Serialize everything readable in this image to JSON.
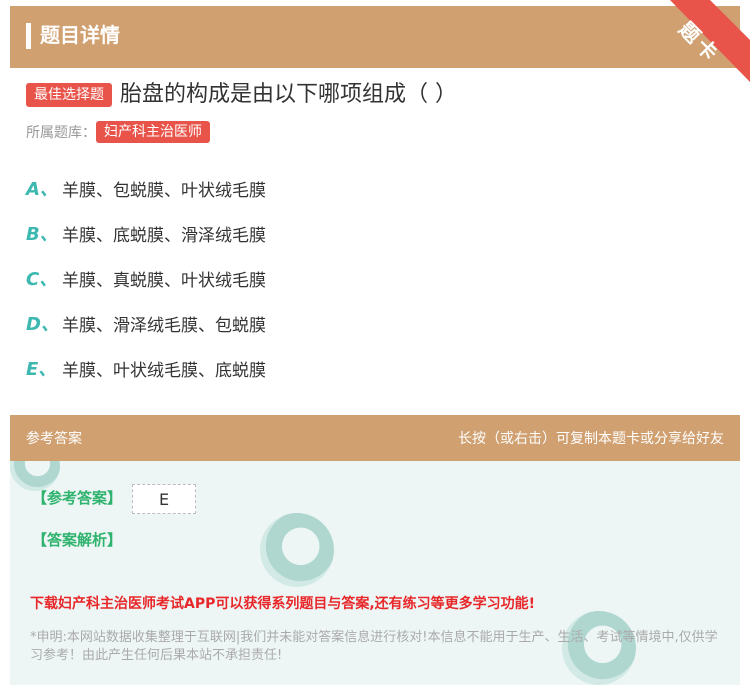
{
  "header": {
    "title": "题目详情",
    "corner_badge": "题卡"
  },
  "question": {
    "type_tag": "最佳选择题",
    "text": "胎盘的构成是由以下哪项组成（ ）",
    "bank_label": "所属题库：",
    "bank_name": "妇产科主治医师"
  },
  "options": [
    {
      "letter": "A、",
      "text": "羊膜、包蜕膜、叶状绒毛膜"
    },
    {
      "letter": "B、",
      "text": "羊膜、底蜕膜、滑泽绒毛膜"
    },
    {
      "letter": "C、",
      "text": "羊膜、真蜕膜、叶状绒毛膜"
    },
    {
      "letter": "D、",
      "text": "羊膜、滑泽绒毛膜、包蜕膜"
    },
    {
      "letter": "E、",
      "text": "羊膜、叶状绒毛膜、底蜕膜"
    }
  ],
  "answer_section": {
    "title": "参考答案",
    "hint": "长按（或右击）可复制本题卡或分享给好友",
    "answer_label": "【参考答案】",
    "answer_value": "E",
    "analysis_label": "【答案解析】",
    "promo": "下载妇产科主治医师考试APP可以获得系列题目与答案,还有练习等更多学习功能!",
    "disclaimer": "*申明:本网站数据收集整理于互联网|我们并未能对答案信息进行核对!本信息不能用于生产、生活、考试等情境中,仅供学习参考！由此产生任何后果本站不承担责任!"
  },
  "colors": {
    "header": "#d0a070",
    "accent_red": "#e8544a",
    "teal": "#3cb8b0",
    "green": "#2fb36e",
    "promo_red": "#e8272a"
  }
}
